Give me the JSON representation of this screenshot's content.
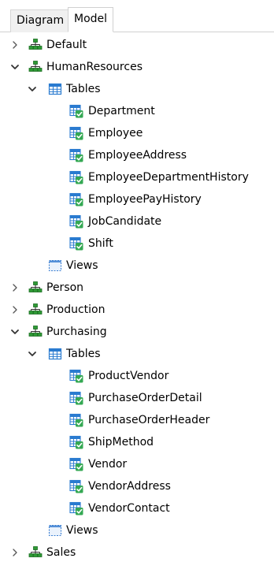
{
  "tabs": [
    {
      "label": "Diagram",
      "active": false
    },
    {
      "label": "Model",
      "active": true
    }
  ],
  "tree": [
    {
      "label": "Default",
      "kind": "schema",
      "state": "collapsed",
      "depth": 0
    },
    {
      "label": "HumanResources",
      "kind": "schema",
      "state": "expanded",
      "depth": 0
    },
    {
      "label": "Tables",
      "kind": "tables",
      "state": "expanded",
      "depth": 1
    },
    {
      "label": "Department",
      "kind": "table",
      "depth": 2
    },
    {
      "label": "Employee",
      "kind": "table",
      "depth": 2
    },
    {
      "label": "EmployeeAddress",
      "kind": "table",
      "depth": 2
    },
    {
      "label": "EmployeeDepartmentHistory",
      "kind": "table",
      "depth": 2
    },
    {
      "label": "EmployeePayHistory",
      "kind": "table",
      "depth": 2
    },
    {
      "label": "JobCandidate",
      "kind": "table",
      "depth": 2
    },
    {
      "label": "Shift",
      "kind": "table",
      "depth": 2
    },
    {
      "label": "Views",
      "kind": "views",
      "depth": 1
    },
    {
      "label": "Person",
      "kind": "schema",
      "state": "collapsed",
      "depth": 0
    },
    {
      "label": "Production",
      "kind": "schema",
      "state": "collapsed",
      "depth": 0
    },
    {
      "label": "Purchasing",
      "kind": "schema",
      "state": "expanded",
      "depth": 0
    },
    {
      "label": "Tables",
      "kind": "tables",
      "state": "expanded",
      "depth": 1
    },
    {
      "label": "ProductVendor",
      "kind": "table",
      "depth": 2
    },
    {
      "label": "PurchaseOrderDetail",
      "kind": "table",
      "depth": 2
    },
    {
      "label": "PurchaseOrderHeader",
      "kind": "table",
      "depth": 2
    },
    {
      "label": "ShipMethod",
      "kind": "table",
      "depth": 2
    },
    {
      "label": "Vendor",
      "kind": "table",
      "depth": 2
    },
    {
      "label": "VendorAddress",
      "kind": "table",
      "depth": 2
    },
    {
      "label": "VendorContact",
      "kind": "table",
      "depth": 2
    },
    {
      "label": "Views",
      "kind": "views",
      "depth": 1
    },
    {
      "label": "Sales",
      "kind": "schema",
      "state": "collapsed",
      "depth": 0
    }
  ],
  "icons": {
    "schema": "schema-icon",
    "tables": "tables-folder-icon",
    "table": "table-icon",
    "views": "views-folder-icon",
    "collapsed": "chevron-right-icon",
    "expanded": "chevron-down-icon"
  },
  "colors": {
    "schema_green": "#2e9a35",
    "schema_dark": "#1d6f23",
    "table_blue": "#2a7bd0",
    "table_check": "#34a853",
    "views_blue": "#3b7fd1",
    "chevron": "#555555"
  }
}
